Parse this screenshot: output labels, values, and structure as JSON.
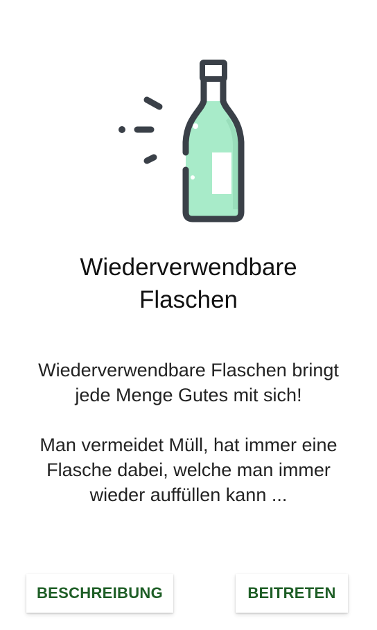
{
  "screen": {
    "title": "Wiederverwendbare Flaschen",
    "description_1": "Wiederverwendbare Flaschen bringt jede Menge Gutes mit sich!",
    "description_2": "Man vermeidet Müll, hat immer eine Flasche dabei, welche man immer wieder auffüllen kann ...",
    "illustration_icon": "bottle-icon"
  },
  "buttons": {
    "left_label": "BESCHREIBUNG",
    "right_label": "BEITRETEN"
  },
  "colors": {
    "accent": "#1e5e26",
    "bottle_fill": "#a8ebc9",
    "outline": "#3a4048"
  }
}
